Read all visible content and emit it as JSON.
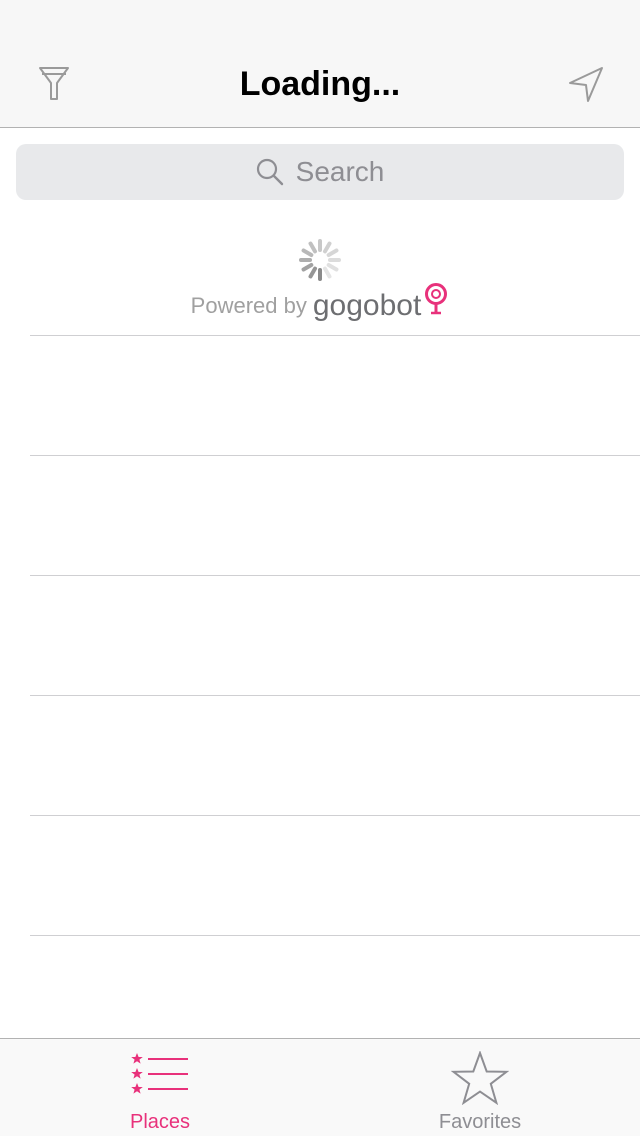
{
  "navbar": {
    "title": "Loading...",
    "left_icon": "filter-icon",
    "right_icon": "location-arrow-icon"
  },
  "search": {
    "placeholder": "Search",
    "icon": "search-icon"
  },
  "loader": {
    "powered_by": "Powered by",
    "brand": "gogobot"
  },
  "list": {
    "rows": [
      {},
      {},
      {},
      {},
      {},
      {}
    ]
  },
  "tabbar": {
    "tabs": [
      {
        "label": "Places",
        "icon": "starred-list-icon",
        "selected": true
      },
      {
        "label": "Favorites",
        "icon": "star-icon",
        "selected": false
      }
    ]
  },
  "colors": {
    "accent": "#e8317b",
    "inactive": "#8e8e93",
    "separator": "#cfcfd2"
  }
}
